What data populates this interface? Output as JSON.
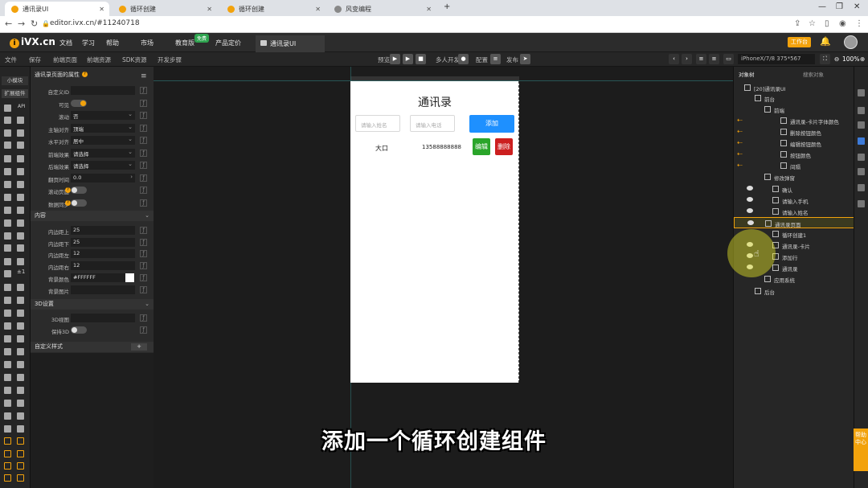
{
  "browser": {
    "tabs": [
      {
        "label": "通讯录UI",
        "active": true
      },
      {
        "label": "循环创建",
        "active": false
      },
      {
        "label": "循环创建",
        "active": false
      },
      {
        "label": "风变编程",
        "active": false
      }
    ],
    "new_tab": "+",
    "url": "editor.ivx.cn/#11240718"
  },
  "app": {
    "logo": "iVX.cn",
    "nav": [
      "文档",
      "学习",
      "帮助",
      "市场",
      "教育版",
      "产品定价"
    ],
    "new_badge": "免费",
    "project_tab": "通讯录UI",
    "workbench": "工作台",
    "zoom": "100%"
  },
  "toolbar": {
    "left": [
      "文件",
      "保存",
      "前端页面",
      "前端资源",
      "SDK资源",
      "开发步骤"
    ],
    "preview": "预览",
    "multi": "多人开发",
    "config": "配置",
    "publish": "发布",
    "device": "iPhoneX/7/8 375*567"
  },
  "leftbar": {
    "tabs": [
      "小模块",
      "扩展组件"
    ],
    "labels": [
      "API",
      "±1"
    ]
  },
  "props": {
    "header": "通讯录页面的属性",
    "rows": [
      {
        "label": "自定义ID",
        "value": ""
      },
      {
        "label": "可见",
        "toggle": "on"
      },
      {
        "label": "滚动",
        "value": "否"
      },
      {
        "label": "主轴对齐",
        "value": "顶端"
      },
      {
        "label": "水平对齐",
        "value": "居中"
      },
      {
        "label": "前端效果",
        "value": "请选择"
      },
      {
        "label": "后端效果",
        "value": "请选择"
      },
      {
        "label": "翻页时间",
        "value": "0.0"
      },
      {
        "label": "滚动页面",
        "toggle": "off"
      },
      {
        "label": "数据同步",
        "toggle": "off"
      }
    ],
    "section_content": "内容",
    "content_rows": [
      {
        "label": "内边距上",
        "value": "25"
      },
      {
        "label": "内边距下",
        "value": "25"
      },
      {
        "label": "内边距左",
        "value": "12"
      },
      {
        "label": "内边距右",
        "value": "12"
      },
      {
        "label": "背景颜色",
        "value": "#FFFFFF"
      },
      {
        "label": "背景图片",
        "value": ""
      }
    ],
    "section_3d": "3D设置",
    "three_d_rows": [
      {
        "label": "3D视图",
        "value": ""
      },
      {
        "label": "保持3D",
        "toggle": "off"
      }
    ],
    "section_custom": "自定义样式",
    "custom_add": "+"
  },
  "phone": {
    "title": "通讯录",
    "name_placeholder": "请输入姓名",
    "phone_placeholder": "请输入电话",
    "add": "添加",
    "row_name": "大口",
    "row_phone": "13588888888",
    "edit": "编辑",
    "delete": "删除"
  },
  "subtitle": "添加一个循环创建组件",
  "tree": {
    "tabs": [
      "对象树",
      "搜索对象"
    ],
    "rows": [
      {
        "label": "[20]通讯录UI",
        "indent": 25
      },
      {
        "label": "前台",
        "indent": 38
      },
      {
        "label": "前端",
        "indent": 50
      },
      {
        "label": "通讯录-卡片字体颜色",
        "indent": 70,
        "arrow": true
      },
      {
        "label": "删除按钮颜色",
        "indent": 70,
        "arrow": true
      },
      {
        "label": "编辑按钮颜色",
        "indent": 70,
        "arrow": true
      },
      {
        "label": "按钮颜色",
        "indent": 70,
        "arrow": true
      },
      {
        "label": "间隔",
        "indent": 70,
        "arrow": true
      },
      {
        "label": "修改弹窗",
        "indent": 50
      },
      {
        "label": "确认",
        "indent": 60,
        "eye": true
      },
      {
        "label": "请输入手机",
        "indent": 60,
        "eye": true
      },
      {
        "label": "请输入姓名",
        "indent": 60,
        "eye": true
      },
      {
        "label": "通讯录页面",
        "indent": 50,
        "eye": true,
        "selected": true
      },
      {
        "label": "循环创建1",
        "indent": 60
      },
      {
        "label": "通讯录-卡片",
        "indent": 60,
        "eye": true
      },
      {
        "label": "添加行",
        "indent": 60,
        "eye": true
      },
      {
        "label": "通讯录",
        "indent": 60,
        "eye": true
      },
      {
        "label": "应用系统",
        "indent": 50
      },
      {
        "label": "后台",
        "indent": 38
      }
    ]
  },
  "help": "帮助中心",
  "colors": {
    "accent": "#f2a20c",
    "add": "#1e90ff",
    "edit": "#2aa52a",
    "delete": "#cc1f1f"
  }
}
